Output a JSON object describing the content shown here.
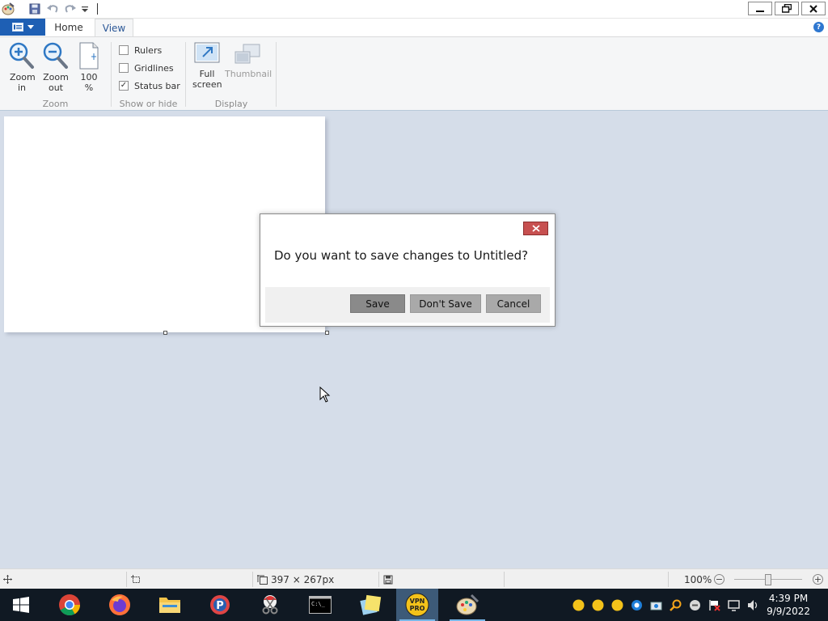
{
  "window": {
    "minimize_icon": "minimize-icon",
    "restore_icon": "restore-icon",
    "close_icon": "close-icon"
  },
  "quick_access": {
    "icons": [
      "paint-app-icon",
      "save-icon",
      "undo-icon",
      "redo-icon",
      "customize-dropdown-icon"
    ]
  },
  "tabs": {
    "home": "Home",
    "view": "View"
  },
  "ribbon": {
    "zoom_in": "Zoom in",
    "zoom_out": "Zoom out",
    "zoom_100": "100 %",
    "zoom_group": "Zoom",
    "rulers": "Rulers",
    "gridlines": "Gridlines",
    "status_bar": "Status bar",
    "rulers_checked": false,
    "gridlines_checked": false,
    "status_bar_checked": true,
    "show_hide_group": "Show or hide",
    "full_screen": "Full screen",
    "thumbnail": "Thumbnail",
    "display_group": "Display"
  },
  "dialog": {
    "message": "Do you want to save changes to Untitled?",
    "save": "Save",
    "dont_save": "Don't Save",
    "cancel": "Cancel"
  },
  "statusbar": {
    "canvas_size": "397 × 267px",
    "zoom": "100%",
    "zoom_level": 0.5
  },
  "taskbar": {
    "apps": [
      "windows-start-icon",
      "chrome-icon",
      "firefox-icon",
      "file-explorer-icon",
      "app-p-icon",
      "snipping-icon",
      "terminal-icon",
      "sticky-notes-icon",
      "vpn-pro-icon",
      "paint-icon"
    ],
    "time": "4:39 PM",
    "date": "9/9/2022"
  },
  "colors": {
    "file_tab": "#1e5fb4",
    "dialog_close": "#c75050",
    "workspace": "#d5dde9",
    "taskbar": "#101923"
  }
}
